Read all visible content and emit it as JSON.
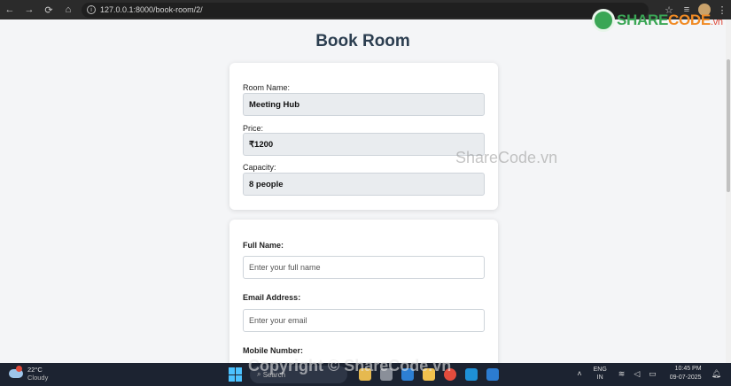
{
  "browser": {
    "url": "127.0.0.1:8000/book-room/2/"
  },
  "watermark": {
    "logo_prefix": "SHARE",
    "logo_middle": "CODE",
    "logo_suffix": ".vn",
    "center_text": "ShareCode.vn",
    "footer_text": "Copyright © ShareCode.vn"
  },
  "page": {
    "title": "Book Room"
  },
  "room": {
    "name_label": "Room Name:",
    "name_value": "Meeting Hub",
    "price_label": "Price:",
    "price_value": "₹1200",
    "capacity_label": "Capacity:",
    "capacity_value": "8 people"
  },
  "form": {
    "full_name_label": "Full Name:",
    "full_name_placeholder": "Enter your full name",
    "email_label": "Email Address:",
    "email_placeholder": "Enter your email",
    "mobile_label": "Mobile Number:"
  },
  "taskbar": {
    "temperature": "22°C",
    "condition": "Cloudy",
    "search_placeholder": "Search",
    "lang_line1": "ENG",
    "lang_line2": "IN",
    "time": "10:45 PM",
    "date": "09-07-2025"
  },
  "colors": {
    "accent": "#2c3e50",
    "readonly_bg": "#e9ecef",
    "logo_green": "#3aa655",
    "logo_orange": "#f08a24"
  }
}
